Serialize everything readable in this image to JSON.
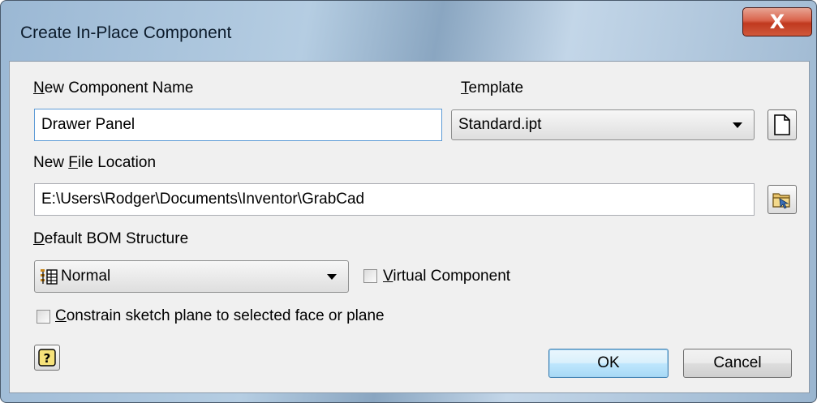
{
  "window": {
    "title": "Create In-Place Component",
    "close_glyph": "X"
  },
  "form": {
    "component_name": {
      "label_prefix": "",
      "label_accel": "N",
      "label_rest": "ew Component Name",
      "value": "Drawer Panel"
    },
    "template": {
      "label_accel": "T",
      "label_rest": "emplate",
      "selected": "Standard.ipt",
      "new_template_icon": "document-icon"
    },
    "file_location": {
      "label_prefix": "New ",
      "label_accel": "F",
      "label_rest": "ile Location",
      "value": "E:\\Users\\Rodger\\Documents\\Inventor\\GrabCad",
      "browse_icon": "folder-browse-icon"
    },
    "bom_structure": {
      "label_accel": "D",
      "label_rest": "efault BOM Structure",
      "selected": "Normal",
      "item_icon": "bom-normal-icon"
    },
    "virtual_component": {
      "label_accel": "V",
      "label_rest": "irtual Component",
      "checked": false
    },
    "constrain_sketch": {
      "label_accel": "C",
      "label_rest": "onstrain sketch plane to selected face or plane",
      "checked": false
    }
  },
  "footer": {
    "help_icon": "help-icon",
    "ok_label": "OK",
    "cancel_label": "Cancel"
  }
}
